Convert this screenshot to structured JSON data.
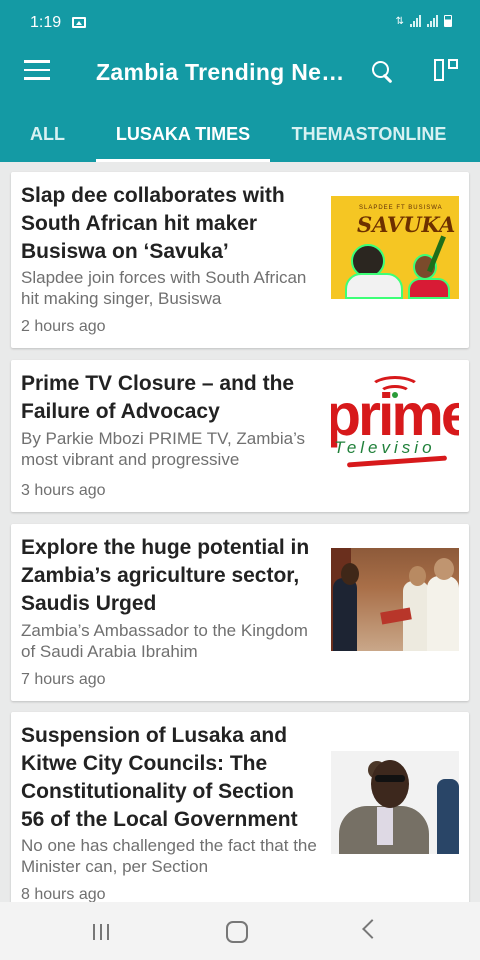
{
  "status_bar": {
    "time": "1:19",
    "icons": [
      "gallery-notification-icon",
      "data-arrows-icon",
      "signal-icon",
      "battery-icon"
    ]
  },
  "app_bar": {
    "title": "Zambia Trending News",
    "menu_icon": "menu-icon",
    "search_icon": "search-icon",
    "layout_icon": "layout-toggle-icon",
    "background_color": "#149aa4"
  },
  "tabs": [
    {
      "label": "ALL",
      "selected": false
    },
    {
      "label": "LUSAKA TIMES",
      "selected": true
    },
    {
      "label": "THEMASTONLINE",
      "selected": false
    }
  ],
  "articles": [
    {
      "title": "Slap dee collaborates with South African hit maker Busiswa on ‘Savuka’",
      "summary": "Slapdee join forces with South African hit making singer, Busiswa",
      "time": "2 hours ago",
      "thumbnail": {
        "brand": "SLAPDEE FT BUSISWA",
        "word": "SAVUKA",
        "icon": "music-artwork-thumbnail"
      }
    },
    {
      "title": "Prime TV Closure – and the Failure of Advocacy",
      "summary": "By Parkie Mbozi PRIME TV, Zambia’s most vibrant and progressive",
      "time": "3 hours ago",
      "thumbnail": {
        "word": "prime",
        "subtitle": "Televisio",
        "icon": "prime-tv-logo-thumbnail"
      }
    },
    {
      "title": "Explore the huge potential in Zambia’s agriculture sector, Saudis Urged",
      "summary": "Zambia’s Ambassador to the Kingdom of Saudi Arabia Ibrahim",
      "time": "7 hours ago",
      "thumbnail": {
        "icon": "ambassador-photo-thumbnail"
      }
    },
    {
      "title": "Suspension of Lusaka and Kitwe City Councils: The Constitutionality of Section 56 of the Local Government",
      "summary": "No one has challenged the fact that the Minister can, per Section",
      "time": "8 hours ago",
      "thumbnail": {
        "icon": "official-photo-thumbnail"
      }
    }
  ],
  "navigation_bar": {
    "recents_icon": "recent-apps-icon",
    "home_icon": "home-icon",
    "back_icon": "back-icon"
  },
  "colors": {
    "accent": "#149aa4",
    "background": "#e9eaea",
    "title_text": "#222222",
    "secondary_text": "#707070"
  }
}
